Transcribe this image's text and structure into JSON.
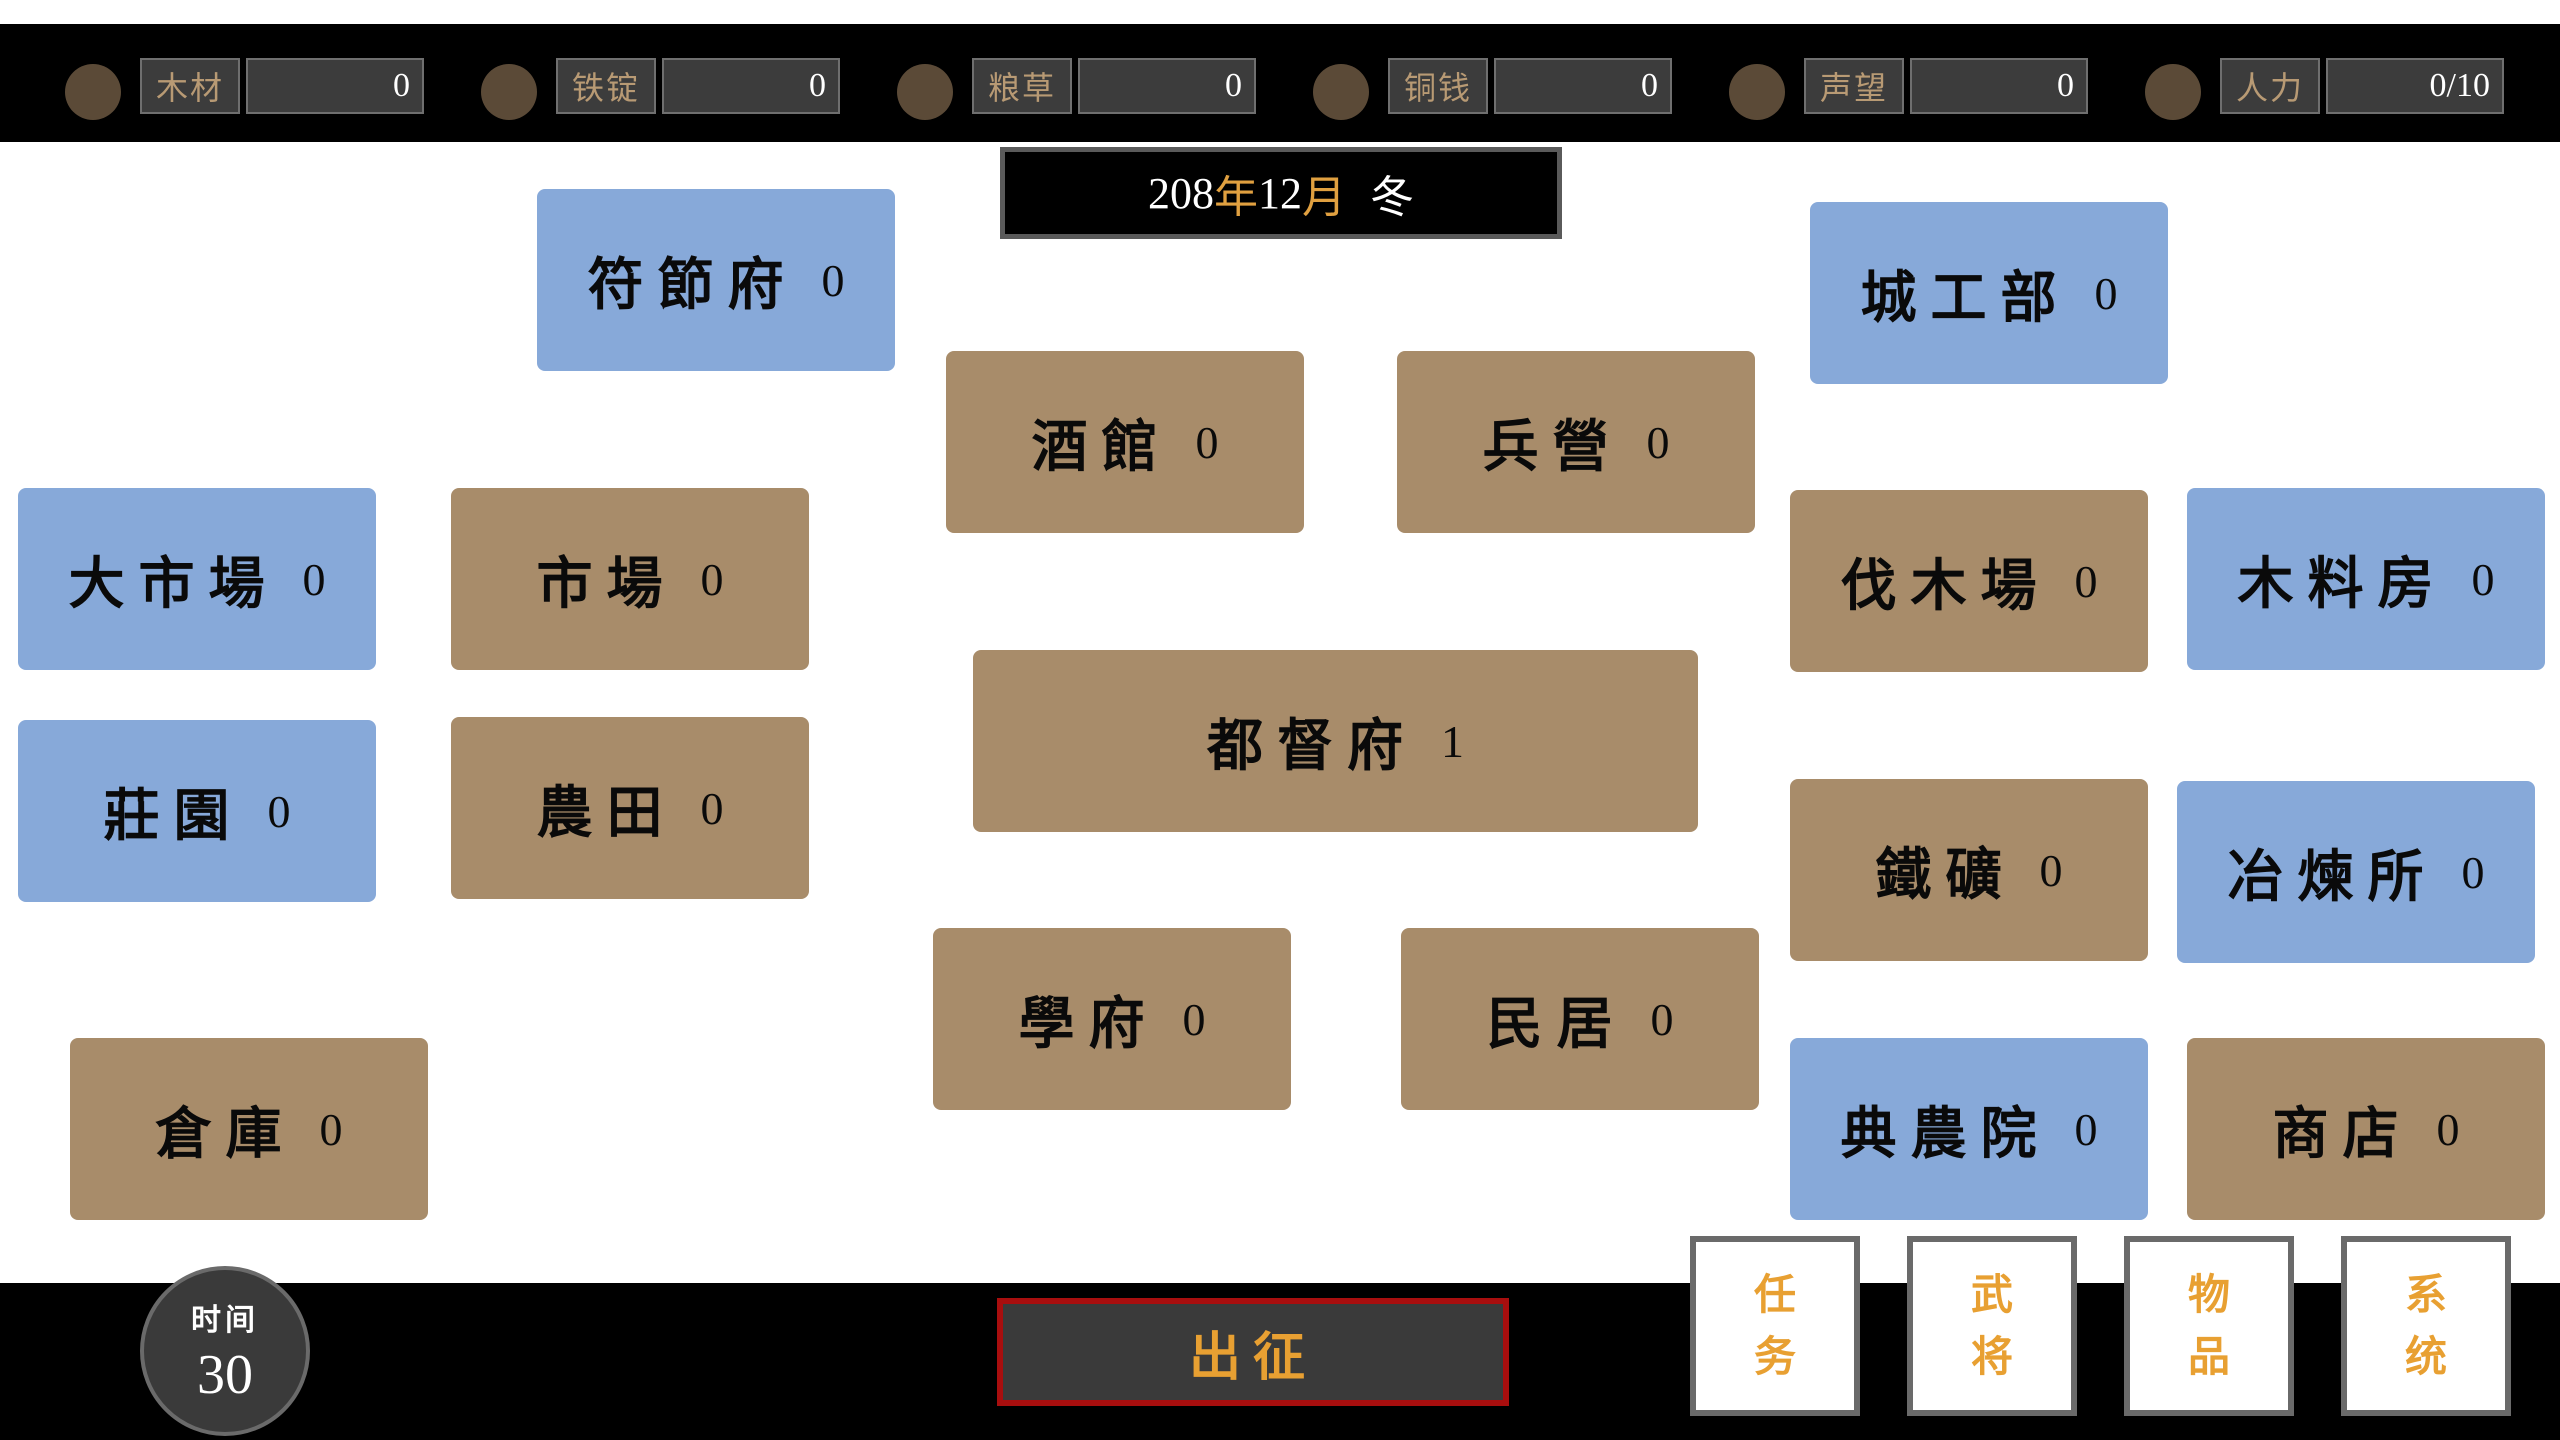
{
  "resources": [
    {
      "icon": "wood-icon",
      "label": "木材",
      "value": "0"
    },
    {
      "icon": "iron-icon",
      "label": "铁锭",
      "value": "0"
    },
    {
      "icon": "grain-icon",
      "label": "粮草",
      "value": "0"
    },
    {
      "icon": "coin-icon",
      "label": "铜钱",
      "value": "0"
    },
    {
      "icon": "prestige-icon",
      "label": "声望",
      "value": "0"
    },
    {
      "icon": "manpower-icon",
      "label": "人力",
      "value": "0/10"
    }
  ],
  "date": {
    "year": "208",
    "year_unit": "年",
    "month": "12",
    "month_unit": "月",
    "season": "冬"
  },
  "buildings": {
    "fujiefu": {
      "name": "符節府",
      "count": "0"
    },
    "chenggongbu": {
      "name": "城工部",
      "count": "0"
    },
    "jiuguan": {
      "name": "酒館",
      "count": "0"
    },
    "bingying": {
      "name": "兵營",
      "count": "0"
    },
    "dashichang": {
      "name": "大市場",
      "count": "0"
    },
    "shichang": {
      "name": "市場",
      "count": "0"
    },
    "famuchang": {
      "name": "伐木場",
      "count": "0"
    },
    "muliaofang": {
      "name": "木料房",
      "count": "0"
    },
    "dudufu": {
      "name": "都督府",
      "count": "1"
    },
    "zhuangyuan": {
      "name": "莊園",
      "count": "0"
    },
    "nongtian": {
      "name": "農田",
      "count": "0"
    },
    "tiekuang": {
      "name": "鐵礦",
      "count": "0"
    },
    "yelian": {
      "name": "冶煉所",
      "count": "0"
    },
    "xuefu": {
      "name": "學府",
      "count": "0"
    },
    "minju": {
      "name": "民居",
      "count": "0"
    },
    "cangku": {
      "name": "倉庫",
      "count": "0"
    },
    "diannong": {
      "name": "典農院",
      "count": "0"
    },
    "shangdian": {
      "name": "商店",
      "count": "0"
    }
  },
  "timer": {
    "label": "时间",
    "value": "30"
  },
  "march": {
    "label": "出征"
  },
  "menu": [
    {
      "line1": "任",
      "line2": "务"
    },
    {
      "line1": "武",
      "line2": "将"
    },
    {
      "line1": "物",
      "line2": "品"
    },
    {
      "line1": "系",
      "line2": "统"
    }
  ],
  "colors": {
    "building_basic": "#a88c6a",
    "building_advanced": "#87a9d9",
    "accent": "#e8a032",
    "march_border": "#a80e0e"
  }
}
